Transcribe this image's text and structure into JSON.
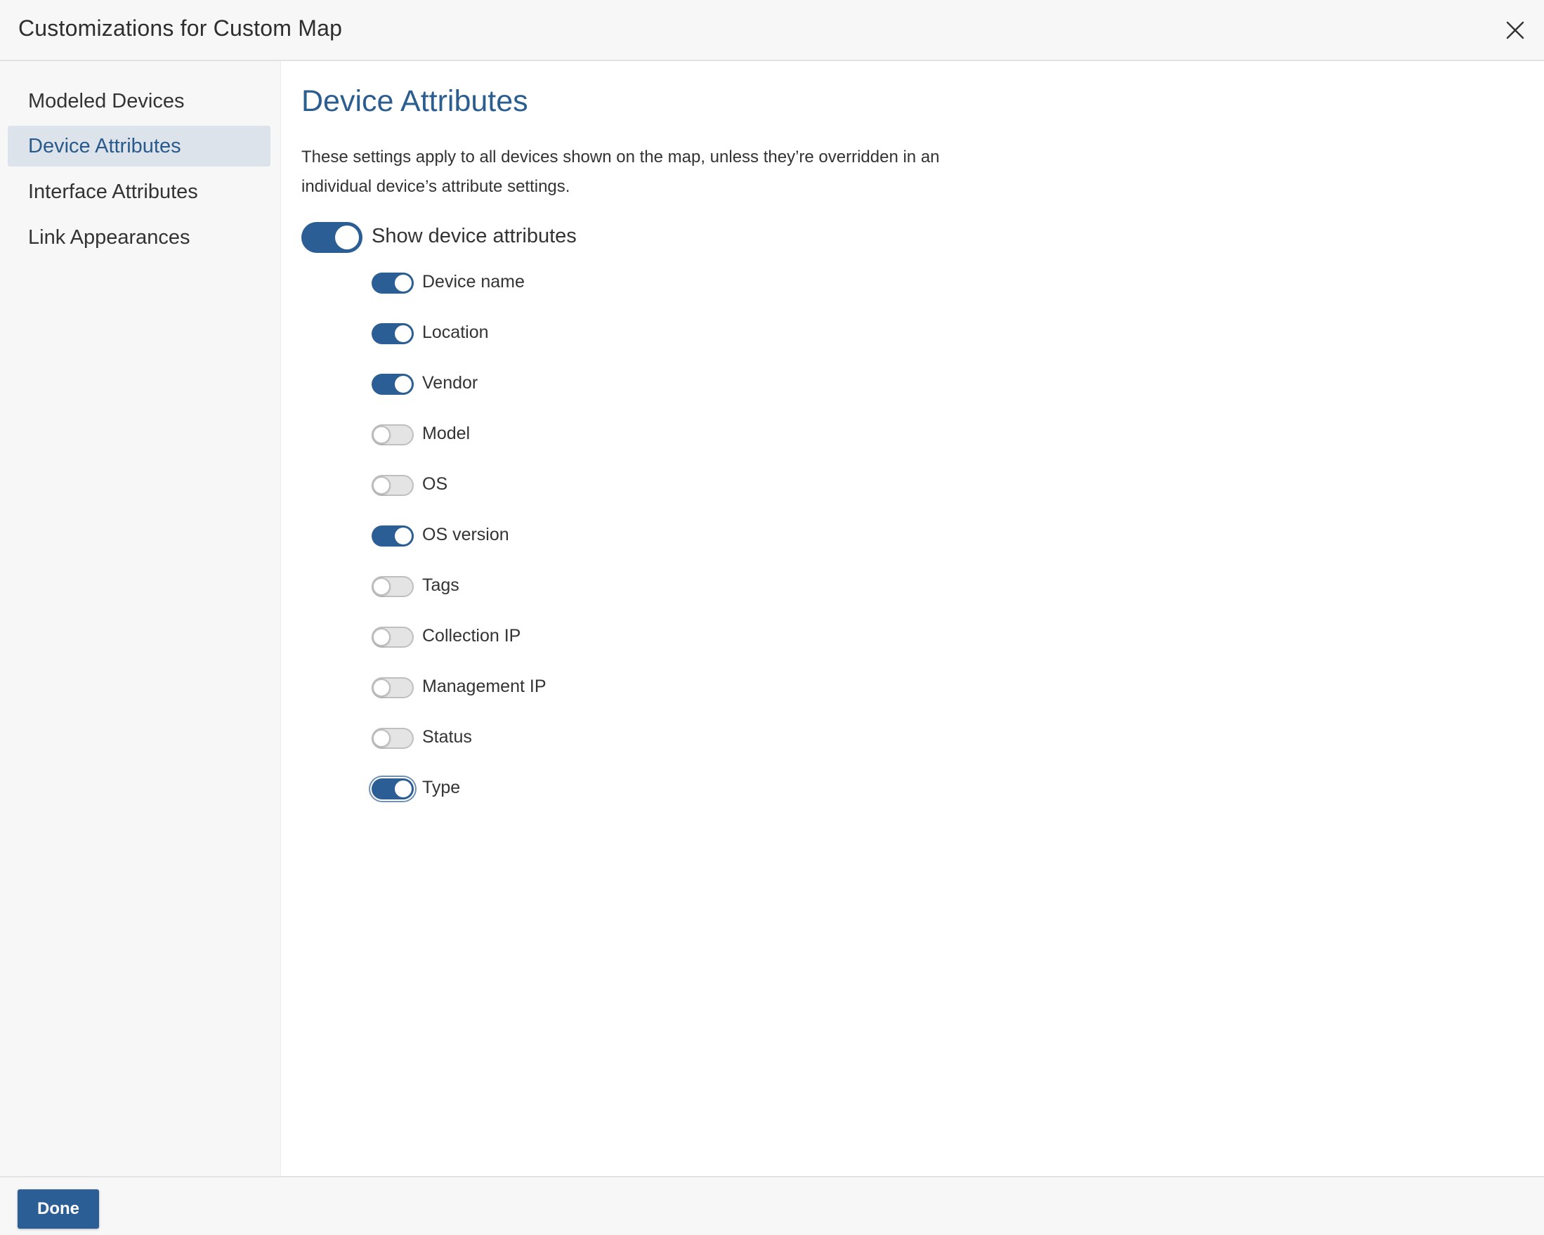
{
  "dialog": {
    "title": "Customizations for Custom Map",
    "close_icon": "close-icon"
  },
  "sidebar": {
    "items": [
      {
        "label": "Modeled Devices",
        "active": false
      },
      {
        "label": "Device Attributes",
        "active": true
      },
      {
        "label": "Interface Attributes",
        "active": false
      },
      {
        "label": "Link Appearances",
        "active": false
      }
    ]
  },
  "main": {
    "title": "Device Attributes",
    "description": "These settings apply to all devices shown on the map, unless they’re overridden in an individual device’s attribute settings.",
    "master_toggle": {
      "label": "Show device attributes",
      "on": true
    },
    "attributes": [
      {
        "label": "Device name",
        "on": true
      },
      {
        "label": "Location",
        "on": true
      },
      {
        "label": "Vendor",
        "on": true
      },
      {
        "label": "Model",
        "on": false
      },
      {
        "label": "OS",
        "on": false
      },
      {
        "label": "OS version",
        "on": true
      },
      {
        "label": "Tags",
        "on": false
      },
      {
        "label": "Collection IP",
        "on": false
      },
      {
        "label": "Management IP",
        "on": false
      },
      {
        "label": "Status",
        "on": false
      },
      {
        "label": "Type",
        "on": true
      }
    ]
  },
  "footer": {
    "done_label": "Done"
  },
  "colors": {
    "accent": "#2b5e95",
    "title_blue": "#2b5e8f",
    "active_nav_bg": "#dce3ea"
  }
}
